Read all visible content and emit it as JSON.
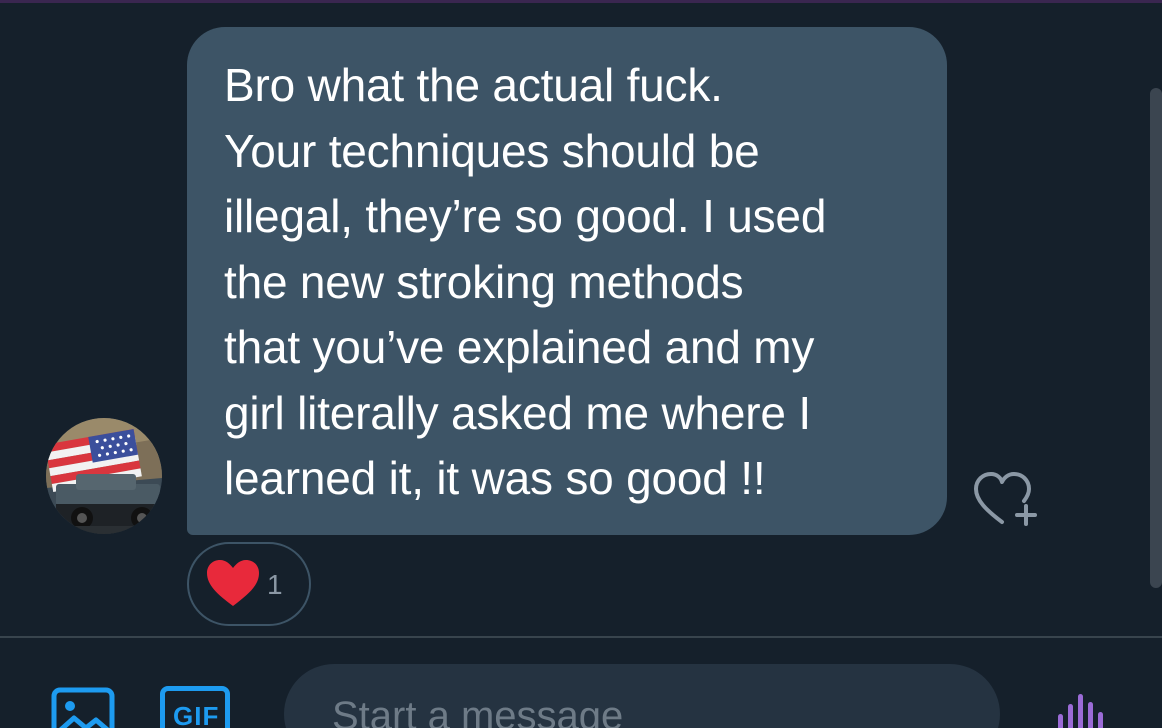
{
  "conversation": {
    "message": {
      "text": "Bro what the actual fuck.\nYour techniques should be\nillegal, they’re so good. I used\nthe new stroking methods\nthat you’ve explained and my\ngirl literally asked me where I\nlearned it, it was so good !!"
    },
    "reaction": {
      "emoji_icon": "heart-icon",
      "count": "1"
    },
    "add_reaction_icon": "heart-plus-icon"
  },
  "composer": {
    "media_icon": "image-icon",
    "gif_label": "GIF",
    "placeholder": "Start a message",
    "voice_icon": "voice-wave-icon"
  },
  "colors": {
    "background": "#15202b",
    "bubble": "#3d5466",
    "accent": "#1d9bf0",
    "heart": "#f91880",
    "voice": "#9b6bd6"
  }
}
